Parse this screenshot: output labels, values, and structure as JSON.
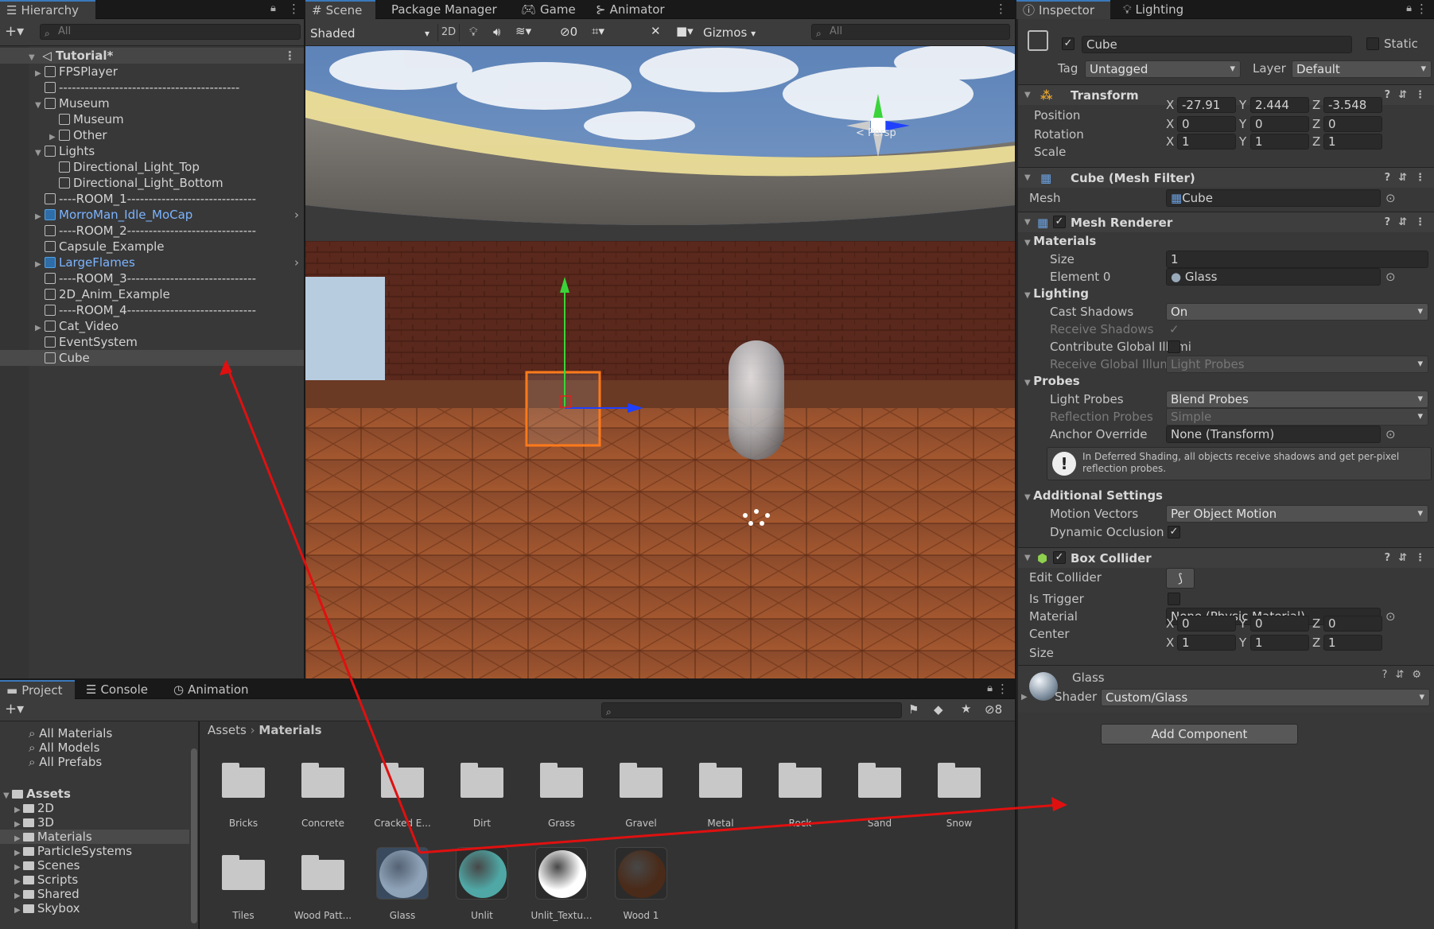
{
  "hierarchy": {
    "tab": "Hierarchy",
    "search_placeholder": "All",
    "scene": "Tutorial*",
    "items": [
      {
        "label": "FPSPlayer",
        "fold": "▶"
      },
      {
        "label": "------------------------------------------",
        "fold": ""
      },
      {
        "label": "Museum",
        "fold": "▼"
      },
      {
        "label": "Museum",
        "fold": ""
      },
      {
        "label": "Other",
        "fold": "▶"
      },
      {
        "label": "Lights",
        "fold": "▼"
      },
      {
        "label": "Directional_Light_Top",
        "fold": ""
      },
      {
        "label": "Directional_Light_Bottom",
        "fold": ""
      },
      {
        "label": "----ROOM_1------------------------------",
        "fold": ""
      },
      {
        "label": "MorroMan_Idle_MoCap",
        "fold": "▶"
      },
      {
        "label": "----ROOM_2------------------------------",
        "fold": ""
      },
      {
        "label": "Capsule_Example",
        "fold": ""
      },
      {
        "label": "LargeFlames",
        "fold": "▶"
      },
      {
        "label": "----ROOM_3------------------------------",
        "fold": ""
      },
      {
        "label": "2D_Anim_Example",
        "fold": ""
      },
      {
        "label": "----ROOM_4------------------------------",
        "fold": ""
      },
      {
        "label": "Cat_Video",
        "fold": "▶"
      },
      {
        "label": "EventSystem",
        "fold": ""
      },
      {
        "label": "Cube",
        "fold": ""
      }
    ]
  },
  "scene_view": {
    "tabs": [
      "Scene",
      "Package Manager",
      "Game",
      "Animator"
    ],
    "shading": "Shaded",
    "mode_2d": "2D",
    "hidden_count": "0",
    "gizmos": "Gizmos",
    "search_placeholder": "All",
    "persp": "< Persp"
  },
  "inspector": {
    "tabs": [
      "Inspector",
      "Lighting"
    ],
    "object_name": "Cube",
    "static_label": "Static",
    "tag_label": "Tag",
    "tag_value": "Untagged",
    "layer_label": "Layer",
    "layer_value": "Default",
    "transform": {
      "title": "Transform",
      "position_label": "Position",
      "rotation_label": "Rotation",
      "scale_label": "Scale",
      "position": [
        "-27.91",
        "2.444",
        "-3.548"
      ],
      "rotation": [
        "0",
        "0",
        "0"
      ],
      "scale": [
        "1",
        "1",
        "1"
      ]
    },
    "mesh_filter": {
      "title": "Cube (Mesh Filter)",
      "mesh_label": "Mesh",
      "mesh_value": "Cube"
    },
    "mesh_renderer": {
      "title": "Mesh Renderer",
      "materials": "Materials",
      "size_label": "Size",
      "size_value": "1",
      "element0_label": "Element 0",
      "element0_value": "Glass",
      "lighting": "Lighting",
      "cast_shadows_label": "Cast Shadows",
      "cast_shadows_value": "On",
      "receive_shadows_label": "Receive Shadows",
      "contribute_gi_label": "Contribute Global Illumi",
      "receive_gi_label": "Receive Global Illumina",
      "receive_gi_value": "Light Probes",
      "probes": "Probes",
      "light_probes_label": "Light Probes",
      "light_probes_value": "Blend Probes",
      "reflection_probes_label": "Reflection Probes",
      "reflection_probes_value": "Simple",
      "anchor_override_label": "Anchor Override",
      "anchor_override_value": "None (Transform)",
      "info": "In Deferred Shading, all objects receive shadows and get per-pixel reflection probes.",
      "additional": "Additional Settings",
      "motion_vectors_label": "Motion Vectors",
      "motion_vectors_value": "Per Object Motion",
      "dynamic_occlusion_label": "Dynamic Occlusion"
    },
    "box_collider": {
      "title": "Box Collider",
      "edit_label": "Edit Collider",
      "trigger_label": "Is Trigger",
      "material_label": "Material",
      "material_value": "None (Physic Material)",
      "center_label": "Center",
      "center": [
        "0",
        "0",
        "0"
      ],
      "size_label": "Size",
      "size": [
        "1",
        "1",
        "1"
      ]
    },
    "material": {
      "name": "Glass",
      "shader_label": "Shader",
      "shader_value": "Custom/Glass"
    },
    "add_component": "Add Component"
  },
  "project": {
    "tabs": [
      "Project",
      "Console",
      "Animation"
    ],
    "hidden_count": "8",
    "favorites": [
      "All Materials",
      "All Models",
      "All Prefabs"
    ],
    "assets_root": "Assets",
    "folders": [
      "2D",
      "3D",
      "Materials",
      "ParticleSystems",
      "Scenes",
      "Scripts",
      "Shared",
      "Skybox"
    ],
    "breadcrumb_root": "Assets",
    "breadcrumb_current": "Materials",
    "grid_folders": [
      "Bricks",
      "Concrete",
      "Cracked E...",
      "Dirt",
      "Grass",
      "Gravel",
      "Metal",
      "Rock",
      "Sand",
      "Snow",
      "Tiles",
      "Wood Patt..."
    ],
    "materials": [
      {
        "name": "Glass",
        "color": "#8fa3b8"
      },
      {
        "name": "Unlit",
        "color": "#4fa8a6"
      },
      {
        "name": "Unlit_Textu...",
        "color": "#ffffff"
      },
      {
        "name": "Wood 1",
        "color": "#4a2a18"
      }
    ]
  },
  "colors": {
    "accent": "#3a79bb",
    "arrow": "#e01010",
    "selection_outline": "#ff7a1a"
  }
}
